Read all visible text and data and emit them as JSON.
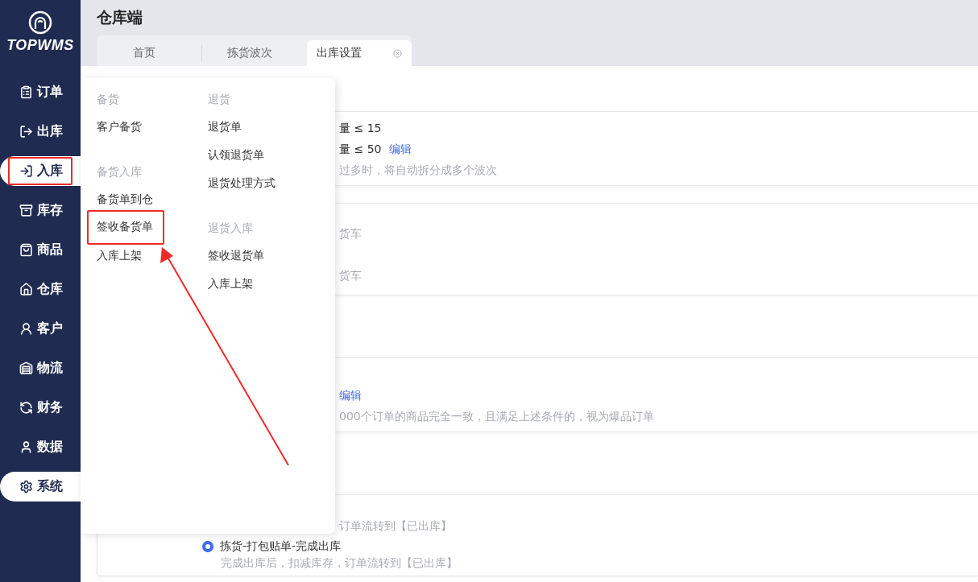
{
  "logo": {
    "text": "TOPWMS"
  },
  "sidebar": {
    "items": [
      {
        "label": "订单",
        "selected": false,
        "boxed": false
      },
      {
        "label": "出库",
        "selected": false,
        "boxed": false
      },
      {
        "label": "入库",
        "selected": true,
        "boxed": true
      },
      {
        "label": "库存",
        "selected": false,
        "boxed": false
      },
      {
        "label": "商品",
        "selected": false,
        "boxed": false
      },
      {
        "label": "仓库",
        "selected": false,
        "boxed": false
      },
      {
        "label": "客户",
        "selected": false,
        "boxed": false
      },
      {
        "label": "物流",
        "selected": false,
        "boxed": false
      },
      {
        "label": "财务",
        "selected": false,
        "boxed": false
      },
      {
        "label": "数据",
        "selected": false,
        "boxed": false
      },
      {
        "label": "系统",
        "selected": true,
        "boxed": false
      }
    ]
  },
  "header": {
    "title": "仓库端"
  },
  "tabs": [
    {
      "label": "首页",
      "selected": false,
      "closable": false
    },
    {
      "label": "拣货波次",
      "selected": false,
      "closable": false
    },
    {
      "label": "出库设置",
      "selected": true,
      "closable": true
    }
  ],
  "menu": {
    "columns": [
      {
        "groups": [
          {
            "title": "备货",
            "items": [
              {
                "label": "客户备货",
                "boxed": false
              }
            ]
          },
          {
            "title": "备货入库",
            "items": [
              {
                "label": "备货单到仓",
                "boxed": false
              },
              {
                "label": "签收备货单",
                "boxed": true
              },
              {
                "label": "入库上架",
                "boxed": false
              }
            ]
          }
        ]
      },
      {
        "groups": [
          {
            "title": "退货",
            "items": [
              {
                "label": "退货单",
                "boxed": false
              },
              {
                "label": "认领退货单",
                "boxed": false
              },
              {
                "label": "退货处理方式",
                "boxed": false
              }
            ]
          },
          {
            "title": "退货入库",
            "items": [
              {
                "label": "签收退货单",
                "boxed": false
              },
              {
                "label": "入库上架",
                "boxed": false
              }
            ]
          }
        ]
      }
    ]
  },
  "annotation_arrow": {
    "shown": true
  },
  "cards": [
    {
      "lines": [
        {
          "kind": "text",
          "text": "量 ≤ 15"
        },
        {
          "kind": "text",
          "text": "量 ≤ 50",
          "link": "编辑"
        },
        {
          "kind": "hint",
          "text": "过多时，将自动拆分成多个波次"
        }
      ]
    },
    {
      "lines": [
        {
          "kind": "hint",
          "text": "货车"
        },
        {
          "kind": "hint",
          "text": "货车"
        }
      ]
    },
    {
      "lines": [
        {
          "kind": "link",
          "link": "编辑"
        },
        {
          "kind": "hint",
          "text": "000个订单的商品完全一致，且满足上述条件的，视为爆品订单"
        }
      ]
    },
    {
      "lines": [
        {
          "kind": "hint",
          "text": "订单流转到【已出库】"
        },
        {
          "kind": "radio",
          "text": "拣货-打包贴单-完成出库",
          "selected": true,
          "description": "完成出库后，扣减库存，订单流转到【已出库】"
        }
      ]
    }
  ]
}
